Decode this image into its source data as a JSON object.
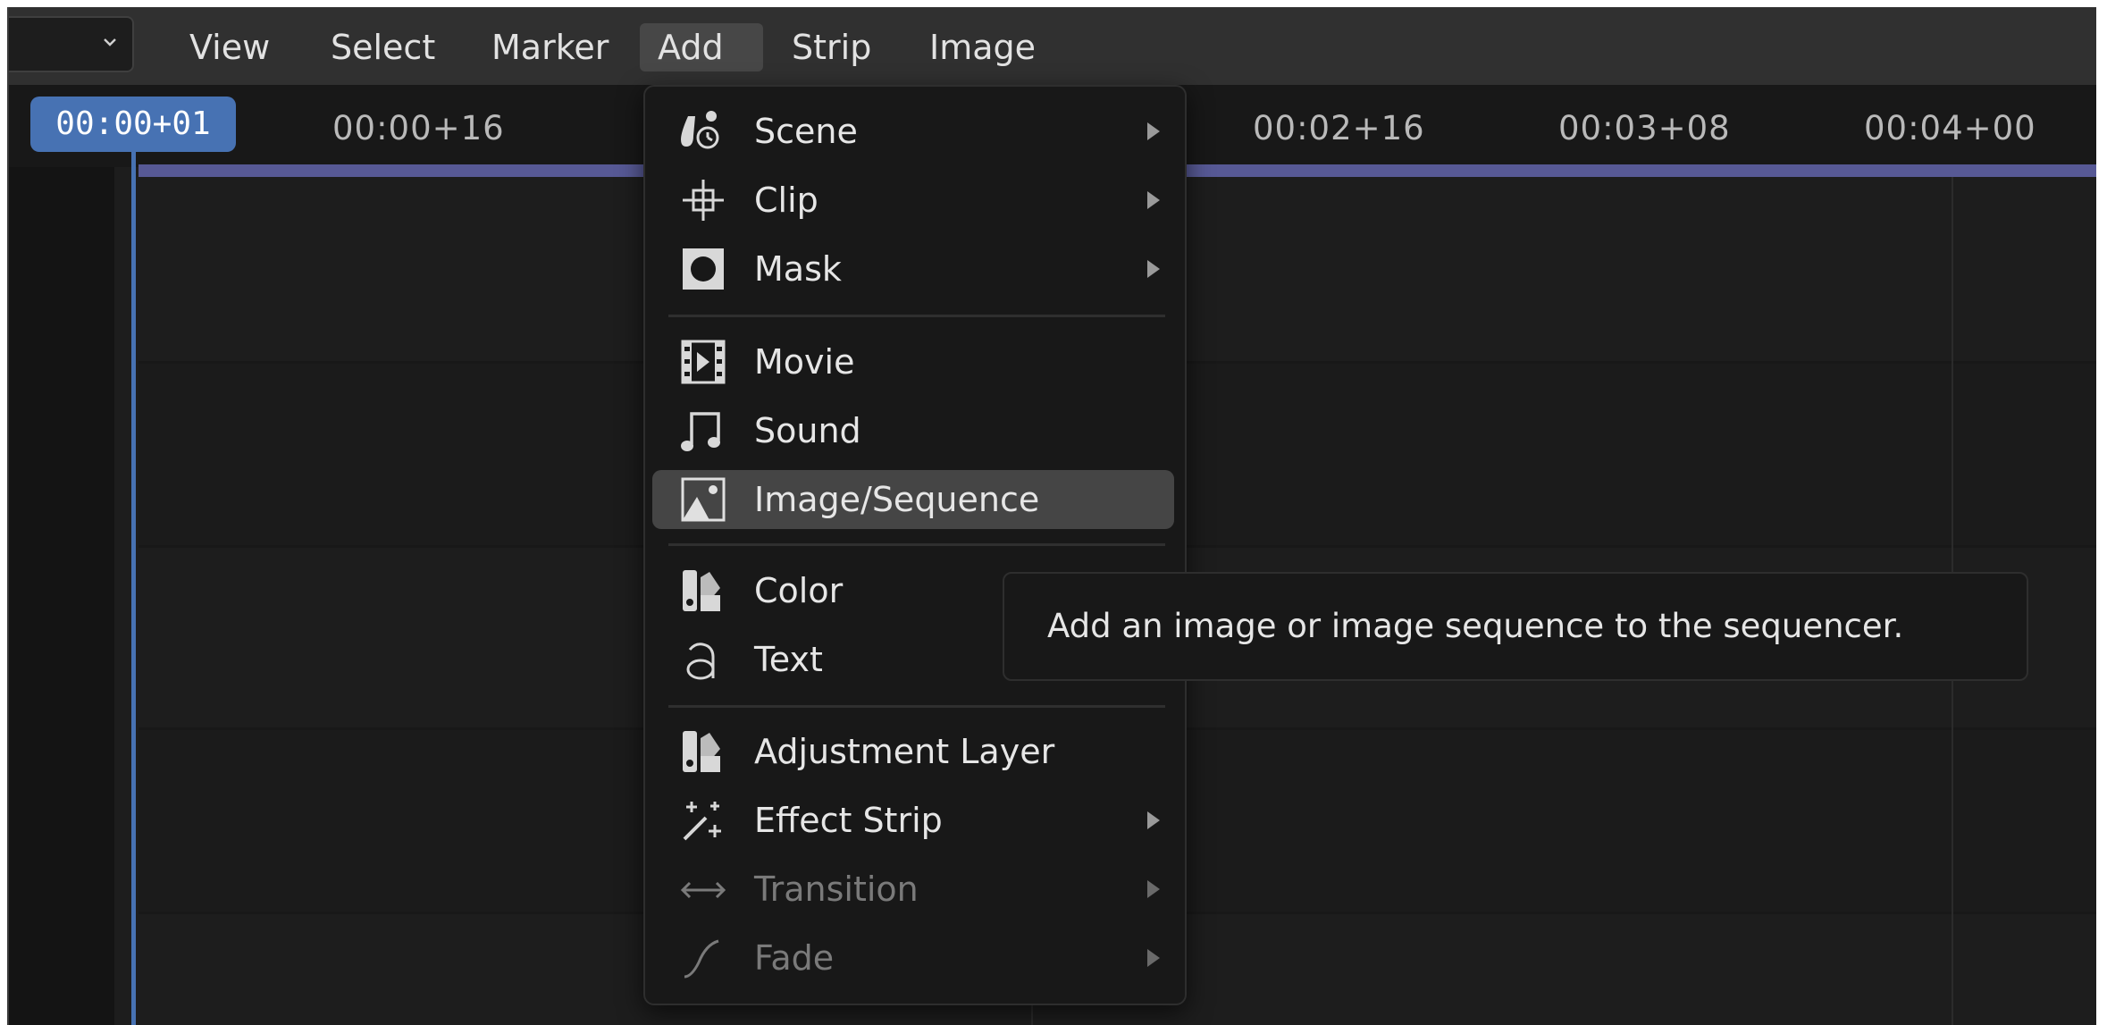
{
  "menubar": {
    "items": [
      "View",
      "Select",
      "Marker",
      "Add",
      "Strip",
      "Image"
    ],
    "active": "Add"
  },
  "timeline": {
    "current_frame": "00:00+01",
    "ticks": [
      "00:00+16",
      "00:02+16",
      "00:03+08",
      "00:04+00"
    ]
  },
  "add_menu": {
    "items": [
      {
        "label": "Scene",
        "icon": "scene-icon",
        "submenu": true,
        "disabled": false
      },
      {
        "label": "Clip",
        "icon": "clip-icon",
        "submenu": true,
        "disabled": false
      },
      {
        "label": "Mask",
        "icon": "mask-icon",
        "submenu": true,
        "disabled": false
      },
      {
        "label": "Movie",
        "icon": "movie-icon",
        "submenu": false,
        "disabled": false
      },
      {
        "label": "Sound",
        "icon": "sound-icon",
        "submenu": false,
        "disabled": false
      },
      {
        "label": "Image/Sequence",
        "icon": "image-icon",
        "submenu": false,
        "disabled": false,
        "highlighted": true
      },
      {
        "label": "Color",
        "icon": "color-icon",
        "submenu": false,
        "disabled": false
      },
      {
        "label": "Text",
        "icon": "text-icon",
        "submenu": false,
        "disabled": false
      },
      {
        "label": "Adjustment Layer",
        "icon": "adjustment-layer-icon",
        "submenu": false,
        "disabled": false
      },
      {
        "label": "Effect Strip",
        "icon": "effect-strip-icon",
        "submenu": true,
        "disabled": false
      },
      {
        "label": "Transition",
        "icon": "transition-icon",
        "submenu": true,
        "disabled": true
      },
      {
        "label": "Fade",
        "icon": "fade-icon",
        "submenu": true,
        "disabled": true
      }
    ]
  },
  "tooltip": {
    "text": "Add an image or image sequence to the sequencer."
  },
  "colors": {
    "accent": "#4772b3",
    "range_bar": "#575995",
    "menu_bg": "#181818",
    "highlight": "#454545"
  }
}
